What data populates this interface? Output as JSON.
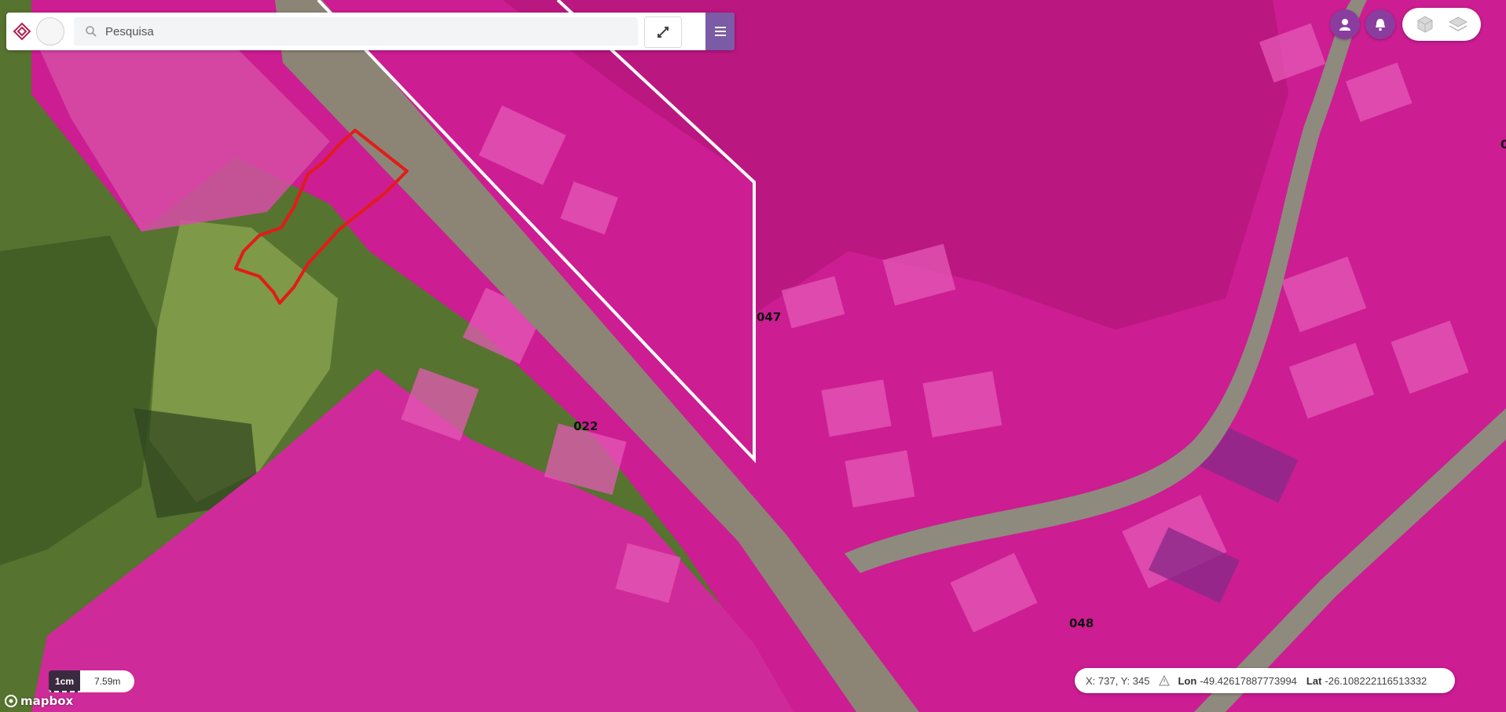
{
  "map": {
    "base_colors": {
      "vegetation": "#4f6a2c",
      "grass": "#7f9a45",
      "road": "#8a8478",
      "parcel_overlay": "#d21e96",
      "parcel_dark": "#b0147e",
      "selection_outline": "#e21b1b",
      "boundary": "#ffffff"
    },
    "lot_labels": [
      "047",
      "022",
      "048"
    ],
    "partial_label": "0"
  },
  "search": {
    "placeholder": "Pesquisa"
  },
  "icons": {
    "search": "search-icon",
    "tools": "tools-icon",
    "menu": "menu-icon",
    "user": "user-icon",
    "bell": "bell-icon",
    "layers_3d": "layer-3d-icon",
    "layers": "layers-icon",
    "warning": "warning-icon"
  },
  "scale": {
    "unit": "1cm",
    "value": "7.59m"
  },
  "attribution": {
    "logo_text": "mapbox"
  },
  "coords": {
    "xy_label": "X: 737, Y: 345",
    "lon_label": "Lon",
    "lon_value": "-49.42617887773994",
    "lat_label": "Lat",
    "lat_value": "-26.108222116513332"
  }
}
